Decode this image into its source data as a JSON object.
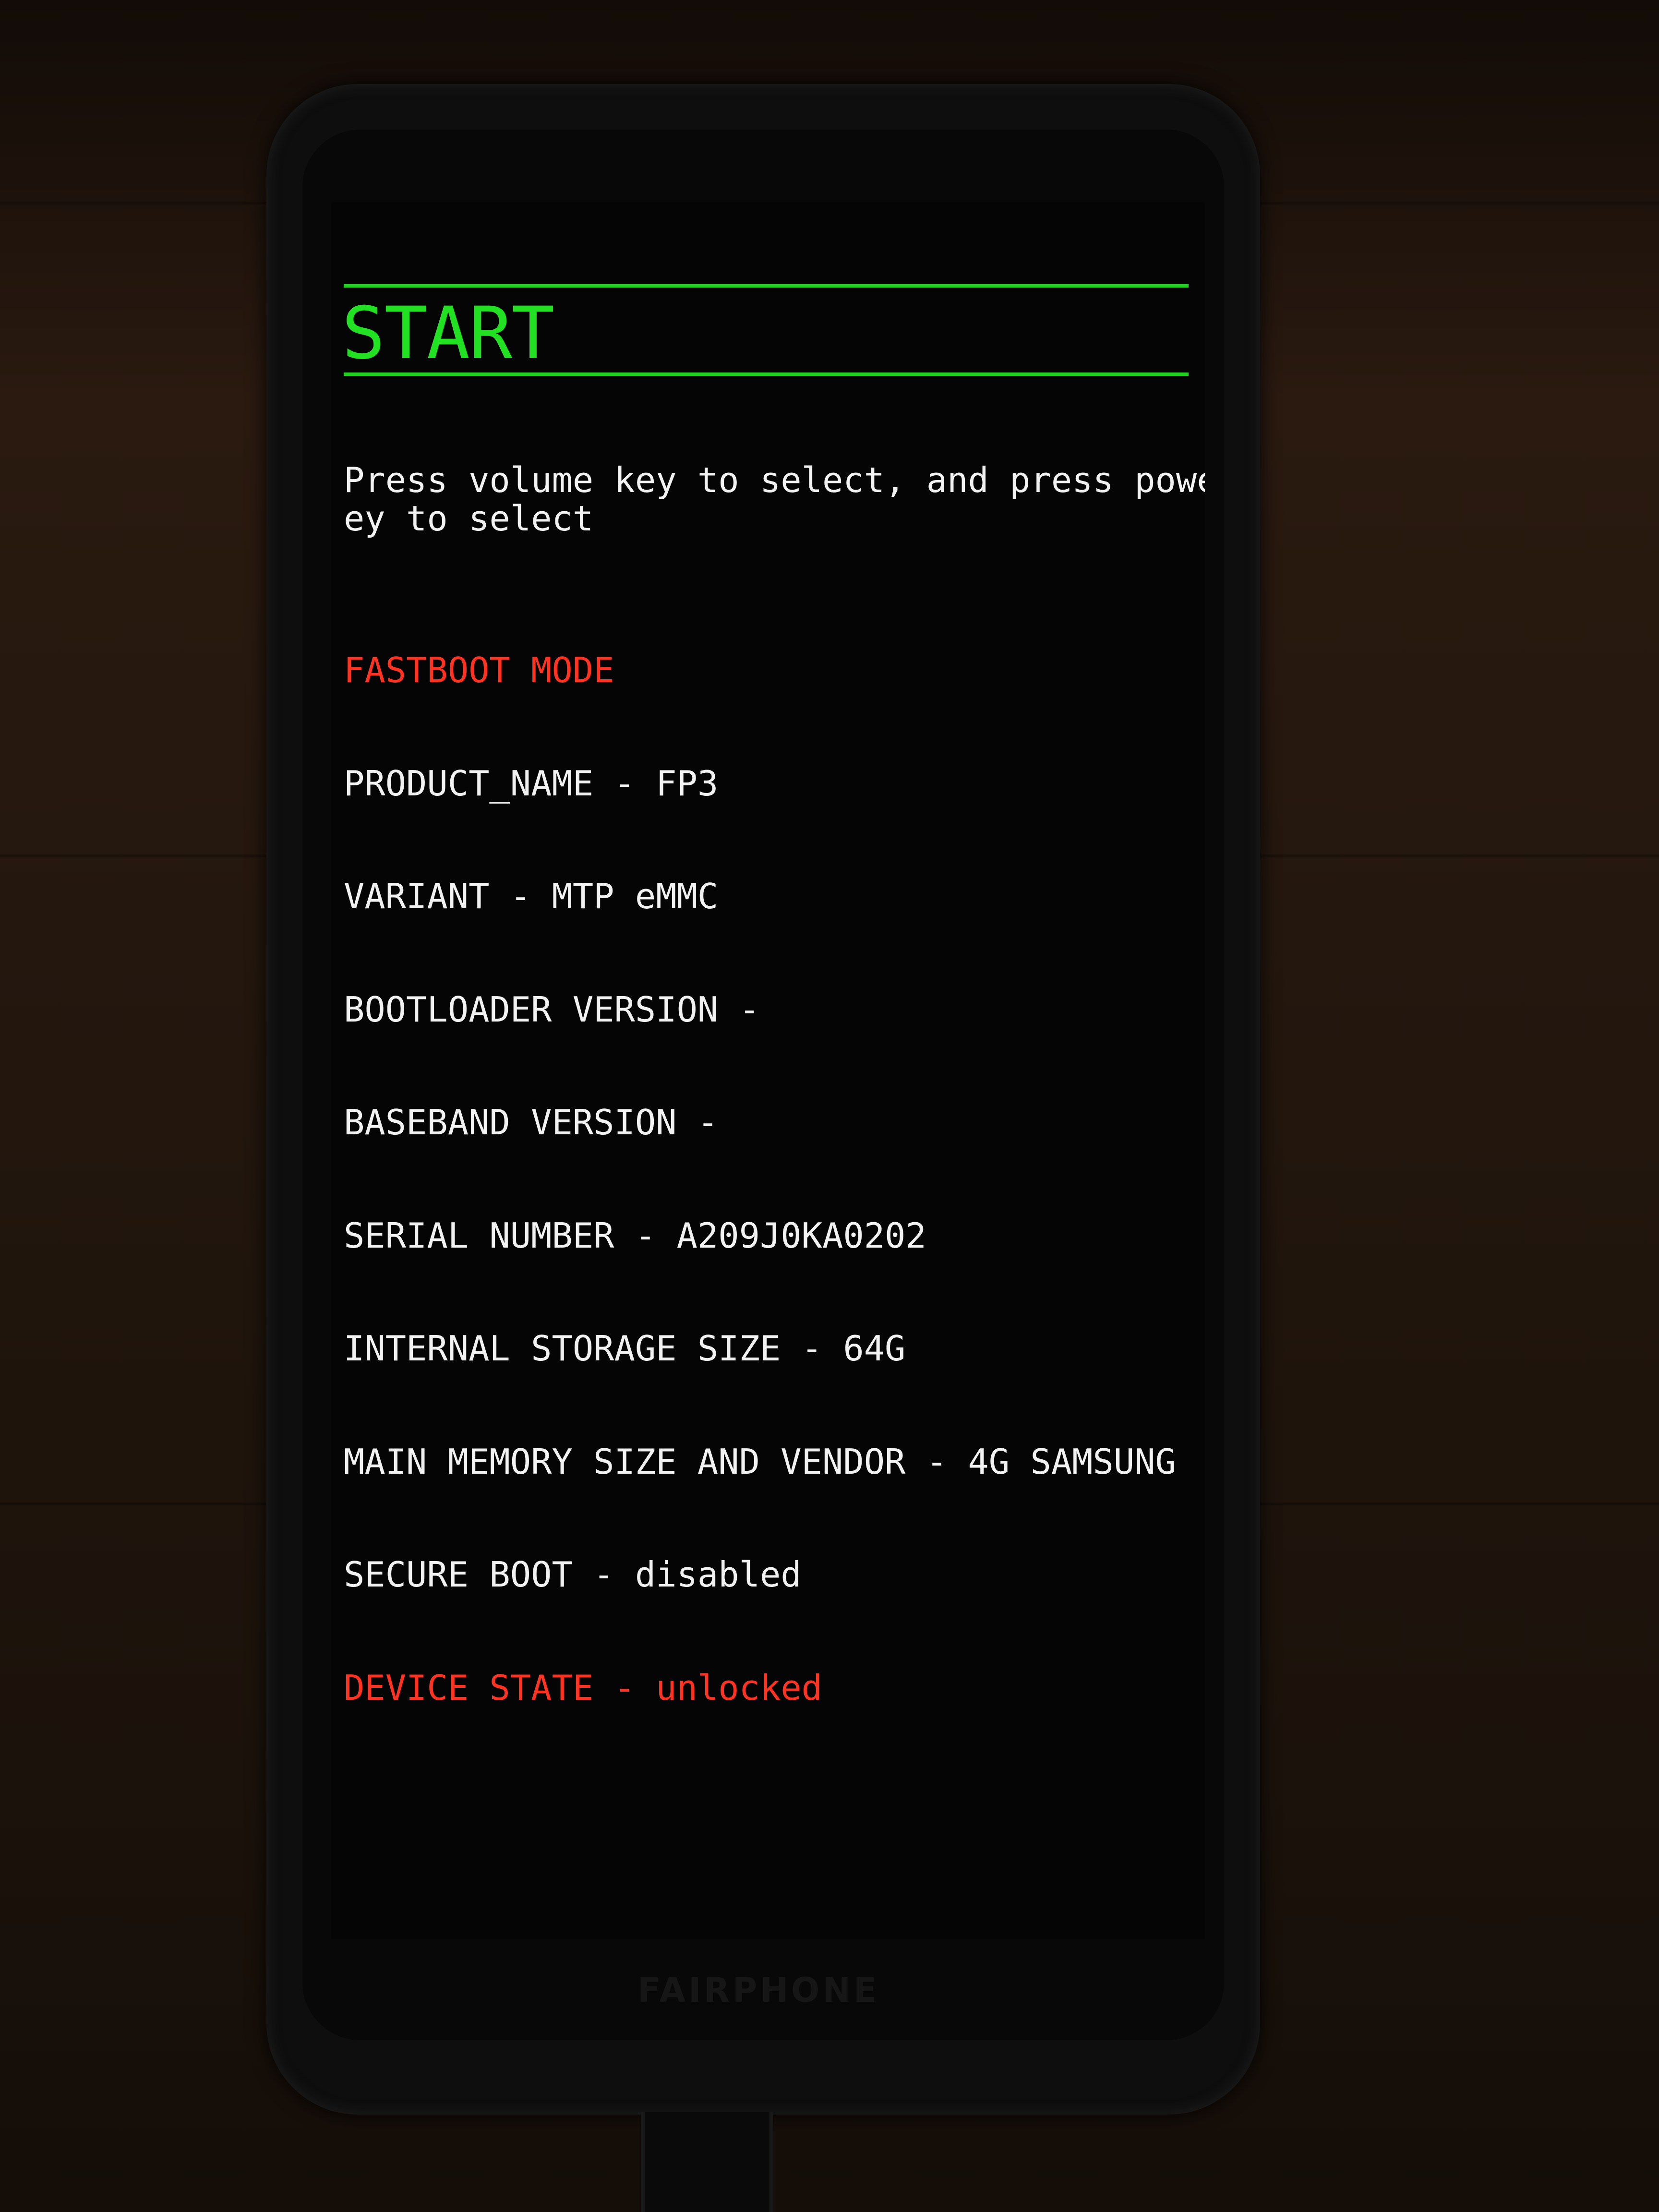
{
  "screen": {
    "title": "START",
    "prompt": "Press volume key to select, and press power k\ney to select",
    "mode": "FASTBOOT MODE",
    "info_lines": [
      "PRODUCT_NAME - FP3",
      "VARIANT - MTP eMMC",
      "BOOTLOADER VERSION -",
      "BASEBAND VERSION -",
      "SERIAL NUMBER - A209J0KA0202",
      "INTERNAL STORAGE SIZE - 64G",
      "MAIN MEMORY SIZE AND VENDOR - 4G SAMSUNG",
      "SECURE BOOT - disabled"
    ],
    "device_state": "DEVICE STATE - unlocked"
  },
  "device": {
    "brand": "FAIRPHONE"
  },
  "colors": {
    "title_green": "#22e022",
    "warning_red": "#ff3322",
    "text_white": "#f2f2f2"
  }
}
